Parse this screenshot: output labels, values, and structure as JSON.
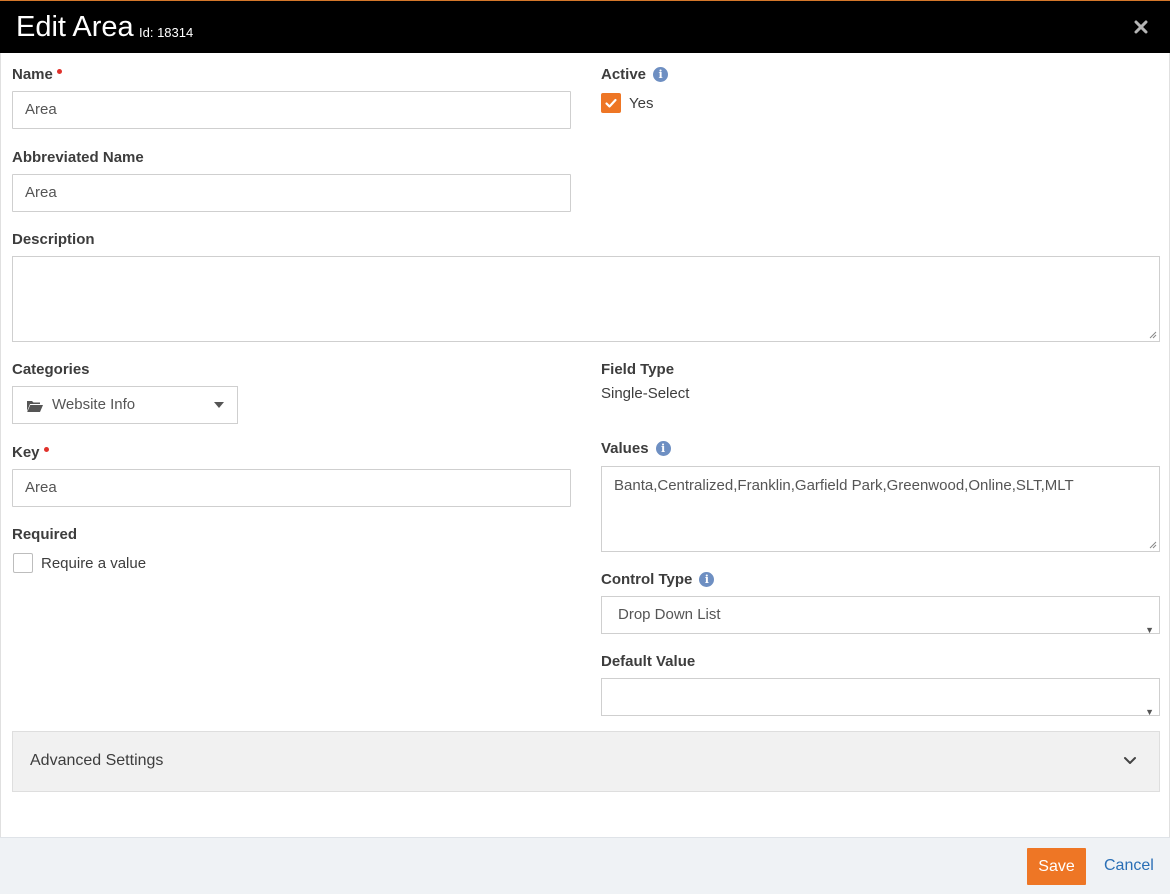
{
  "header": {
    "title": "Edit Area",
    "id_text": "Id: 18314",
    "close_icon": "close-icon"
  },
  "form": {
    "name": {
      "label": "Name",
      "value": "Area"
    },
    "active": {
      "label": "Active",
      "checkbox_label": "Yes",
      "checked": true
    },
    "abbreviated_name": {
      "label": "Abbreviated Name",
      "value": "Area"
    },
    "description": {
      "label": "Description",
      "value": ""
    },
    "categories": {
      "label": "Categories",
      "value": "Website Info",
      "icon": "folder-open-icon"
    },
    "field_type": {
      "label": "Field Type",
      "value": "Single-Select"
    },
    "key": {
      "label": "Key",
      "value": "Area"
    },
    "values": {
      "label": "Values",
      "value": "Banta,Centralized,Franklin,Garfield Park,Greenwood,Online,SLT,MLT"
    },
    "required": {
      "label": "Required",
      "checkbox_label": "Require a value",
      "checked": false
    },
    "control_type": {
      "label": "Control Type",
      "value": "Drop Down List"
    },
    "default_value": {
      "label": "Default Value",
      "value": ""
    }
  },
  "advanced": {
    "label": "Advanced Settings"
  },
  "footer": {
    "save_label": "Save",
    "cancel_label": "Cancel"
  },
  "colors": {
    "accent": "#ee7625",
    "header_bg": "#000000",
    "link": "#2a6fb5",
    "info": "#6e8fc2",
    "required": "#e0312b"
  }
}
